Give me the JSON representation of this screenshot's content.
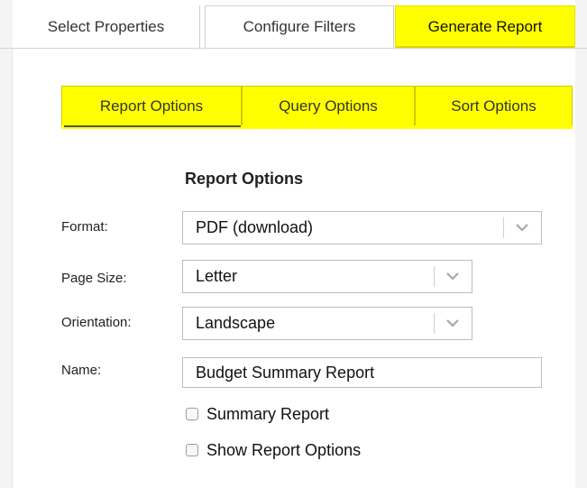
{
  "top_tabs": [
    {
      "label": "Select Properties",
      "active": false
    },
    {
      "label": "Configure Filters",
      "active": false
    },
    {
      "label": "Generate Report",
      "active": true
    }
  ],
  "sub_tabs": [
    {
      "label": "Report Options",
      "active": true
    },
    {
      "label": "Query Options",
      "active": false
    },
    {
      "label": "Sort Options",
      "active": false
    }
  ],
  "form": {
    "section_title": "Report Options",
    "format": {
      "label": "Format:",
      "value": "PDF (download)"
    },
    "page_size": {
      "label": "Page Size:",
      "value": "Letter"
    },
    "orientation": {
      "label": "Orientation:",
      "value": "Landscape"
    },
    "name": {
      "label": "Name:",
      "value": "Budget Summary Report"
    },
    "summary_report": {
      "label": "Summary Report",
      "checked": false
    },
    "show_report_options": {
      "label": "Show Report Options",
      "checked": false
    }
  },
  "colors": {
    "highlight": "#ffff00",
    "border": "#bdbdbd",
    "text": "#222222"
  },
  "icons": {
    "dropdown": "chevron-down-icon"
  }
}
